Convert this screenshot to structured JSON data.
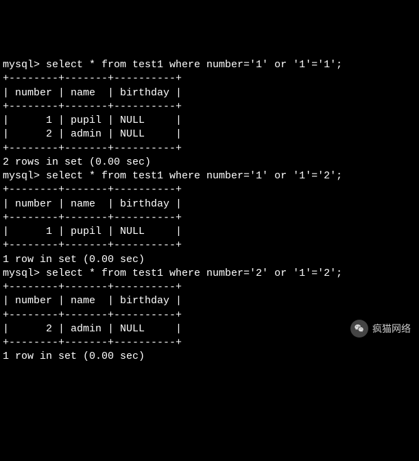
{
  "queries": [
    {
      "prompt": "mysql>",
      "sql": "select * from test1 where number='1' or '1'='1';",
      "columns": [
        "number",
        "name",
        "birthday"
      ],
      "rows": [
        {
          "number": "1",
          "name": "pupil",
          "birthday": "NULL"
        },
        {
          "number": "2",
          "name": "admin",
          "birthday": "NULL"
        }
      ],
      "footer": "2 rows in set (0.00 sec)"
    },
    {
      "prompt": "mysql>",
      "sql": "select * from test1 where number='1' or '1'='2';",
      "columns": [
        "number",
        "name",
        "birthday"
      ],
      "rows": [
        {
          "number": "1",
          "name": "pupil",
          "birthday": "NULL"
        }
      ],
      "footer": "1 row in set (0.00 sec)"
    },
    {
      "prompt": "mysql>",
      "sql": "select * from test1 where number='2' or '1'='2';",
      "columns": [
        "number",
        "name",
        "birthday"
      ],
      "rows": [
        {
          "number": "2",
          "name": "admin",
          "birthday": "NULL"
        }
      ],
      "footer": "1 row in set (0.00 sec)"
    }
  ],
  "watermark": {
    "text": "疯猫网络"
  }
}
